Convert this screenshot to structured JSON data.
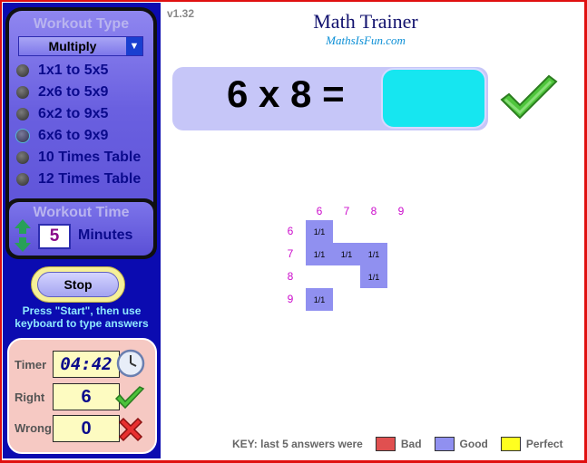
{
  "version": "v1.32",
  "app": {
    "title": "Math Trainer",
    "site": "MathsIsFun.com"
  },
  "workout_type": {
    "title": "Workout Type",
    "selected": "Multiply",
    "options": [
      {
        "label": "1x1 to 5x5",
        "selected": false
      },
      {
        "label": "2x6 to 5x9",
        "selected": false
      },
      {
        "label": "6x2 to 9x5",
        "selected": false
      },
      {
        "label": "6x6 to 9x9",
        "selected": true
      },
      {
        "label": "10 Times Table",
        "selected": false
      },
      {
        "label": "12 Times Table",
        "selected": false
      }
    ]
  },
  "workout_time": {
    "title": "Workout Time",
    "value": "5",
    "unit": "Minutes"
  },
  "controls": {
    "stop_label": "Stop",
    "hint": "Press \"Start\", then use keyboard to type answers"
  },
  "stats": {
    "timer_label": "Timer",
    "timer_value": "04:42",
    "right_label": "Right",
    "right_value": "6",
    "wrong_label": "Wrong",
    "wrong_value": "0"
  },
  "question": {
    "text": "6 x 8 =",
    "answer": ""
  },
  "grid": {
    "columns": [
      "6",
      "7",
      "8",
      "9"
    ],
    "rows": [
      "6",
      "7",
      "8",
      "9"
    ],
    "cells": [
      {
        "row": 0,
        "col": 0,
        "label": "1/1"
      },
      {
        "row": 1,
        "col": 0,
        "label": "1/1"
      },
      {
        "row": 1,
        "col": 1,
        "label": "1/1"
      },
      {
        "row": 1,
        "col": 2,
        "label": "1/1"
      },
      {
        "row": 2,
        "col": 2,
        "label": "1/1"
      },
      {
        "row": 3,
        "col": 0,
        "label": "1/1"
      }
    ]
  },
  "key": {
    "label": "KEY:  last 5 answers were",
    "items": [
      {
        "label": "Bad",
        "color": "#e05050"
      },
      {
        "label": "Good",
        "color": "#9090f0"
      },
      {
        "label": "Perfect",
        "color": "#ffff20"
      }
    ]
  },
  "colors": {
    "panel_bg": "#0b0bb0",
    "accent_cyan": "#16e6f0",
    "grid_good": "#9090f0",
    "header_magenta": "#cc0ccc"
  }
}
